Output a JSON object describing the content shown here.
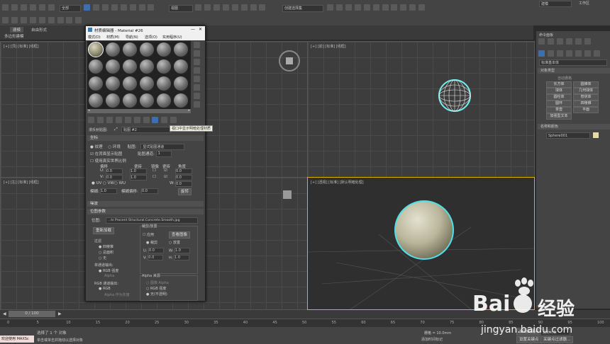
{
  "toolbar": {
    "scope": "全部",
    "view_mode": "视图",
    "selection_set": "创建选择集",
    "right_field": "建模",
    "workspace": "工作区"
  },
  "ribbon": {
    "tabs": [
      "建模",
      "自由形式"
    ],
    "sub_label": "多边形建模"
  },
  "viewport_labels": {
    "top_left": "[+] [顶] [标准] [线框]",
    "top_right": "[+] [前] [标准] [线框]",
    "bottom_left": "[+] [左] [标准] [线框]",
    "bottom_right": "[+] [透视] [标准] [默认明暗处理]"
  },
  "material_editor": {
    "title": "材质编辑器 - Material #26",
    "menu": [
      "模式(D)",
      "材质(M)",
      "导航(N)",
      "选项(O)",
      "实用程序(U)"
    ],
    "tooltip": "视口中显示明暗处理材质",
    "name_row_label": "漫反射贴图:",
    "map_name": "贴图 #2",
    "coord_section": "坐标",
    "texture_radio": "纹理",
    "env_radio": "环境",
    "mapping_label": "贴图:",
    "mapping_value": "显式贴图通道",
    "show_map_back": "在背面显示贴图",
    "map_channel_label": "贴图通道:",
    "map_channel": "1",
    "real_world": "使用真实世界比例",
    "col_offset": "偏移",
    "col_tiling": "瓷砖",
    "col_mirror": "镜像",
    "col_tile": "瓷砖",
    "col_angle": "角度",
    "u_label": "U:",
    "v_label": "V:",
    "w_label": "W:",
    "u_offset": "0.0",
    "u_tiling": "1.0",
    "u_angle": "0.0",
    "v_offset": "0.0",
    "v_tiling": "1.0",
    "v_angle": "0.0",
    "w_angle": "0.0",
    "uv": "UV",
    "vw": "VW",
    "wu": "WU",
    "blur_label": "模糊:",
    "blur": "1.0",
    "blur_offset_label": "模糊偏移:",
    "blur_offset": "0.0",
    "rotate": "旋转",
    "noise_section": "噪波",
    "bitmap_section": "位图参数",
    "bitmap_label": "位图:",
    "bitmap_path": "...ts Procent Structural.Concrete.Smooth.jpg",
    "reload": "重新加载",
    "crop_title": "裁剪/放置",
    "apply": "应用",
    "view_image": "查看图像",
    "crop": "裁剪",
    "place": "放置",
    "filter_title": "过滤",
    "four_corner": "四棱锥",
    "summed_area": "总面积",
    "none": "无",
    "u_small": "U:",
    "v_small": "V:",
    "w_small": "W:",
    "h_small": "H:",
    "crop_u": "0.0",
    "crop_v": "0.0",
    "crop_w": "1.0",
    "crop_h": "1.0",
    "mono_title": "单通道输出:",
    "rgb_intensity": "RGB 强度",
    "alpha": "Alpha",
    "rgb_out_title": "RGB 通道输出:",
    "rgb": "RGB",
    "alpha_as_gray": "Alpha 作为灰度",
    "alpha_src_title": "Alpha 来源",
    "img_alpha": "图像 Alpha",
    "rgb_int2": "RGB 强度",
    "none_opaque": "无(不透明)"
  },
  "command_panel": {
    "header": "命令面板",
    "category": "标准基本体",
    "object_type_title": "对象类型",
    "autogrid": "自动栅格",
    "buttons": [
      "长方体",
      "圆锥体",
      "球体",
      "几何球体",
      "圆柱体",
      "管状体",
      "圆环",
      "四棱锥",
      "茶壶",
      "平面",
      "加强型文本"
    ],
    "name_color_title": "名称和颜色",
    "object_name": "Sphere001"
  },
  "timeline": {
    "frame": "0 / 100",
    "ticks": [
      "0",
      "5",
      "10",
      "15",
      "20",
      "25",
      "30",
      "35",
      "40",
      "45",
      "50",
      "55",
      "60",
      "65",
      "70",
      "75",
      "80",
      "85",
      "90",
      "95",
      "100"
    ]
  },
  "status": {
    "welcome": "欢迎使用 MAXSc",
    "selected": "选择了 1 个 对象",
    "hint": "单击或单击并拖动以选择对象",
    "grid": "栅格 = 10.0mm",
    "add_time_tag": "添加时间标记",
    "auto_key": "自动关键点",
    "set_key": "设置关键点",
    "selected_obj": "选定对象",
    "key_filter": "关键点过滤器..."
  },
  "watermark": {
    "brand": "Bai",
    "brand_cn": "经验",
    "url": "jingyan.baidu.com"
  }
}
